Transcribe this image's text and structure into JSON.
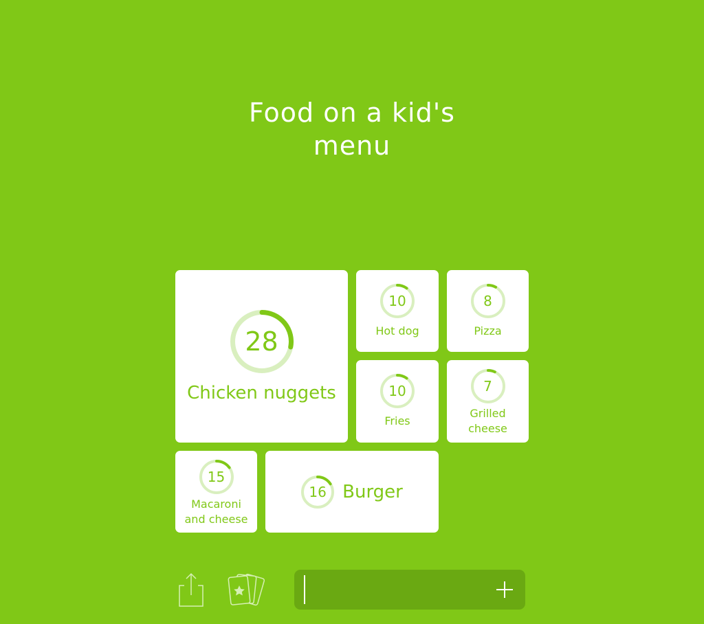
{
  "puzzle": {
    "title": "Food on a kid's menu"
  },
  "answers": [
    {
      "id": "chicken-nuggets",
      "label": "Chicken nuggets",
      "percent": "28",
      "fraction": 0.28
    },
    {
      "id": "hot-dog",
      "label": "Hot dog",
      "percent": "10",
      "fraction": 0.1
    },
    {
      "id": "pizza",
      "label": "Pizza",
      "percent": "8",
      "fraction": 0.08
    },
    {
      "id": "fries",
      "label": "Fries",
      "percent": "10",
      "fraction": 0.1
    },
    {
      "id": "grilled-cheese",
      "label": "Grilled cheese",
      "label_lines": [
        "Grilled",
        "cheese"
      ],
      "percent": "7",
      "fraction": 0.07
    },
    {
      "id": "macaroni-and-cheese",
      "label": "Macaroni and cheese",
      "label_lines": [
        "Macaroni",
        "and cheese"
      ],
      "percent": "15",
      "fraction": 0.15
    },
    {
      "id": "burger",
      "label": "Burger",
      "percent": "16",
      "fraction": 0.16
    }
  ],
  "toolbar": {
    "share_icon": "share-icon",
    "hints_icon": "cards-star-icon",
    "input_value": "",
    "add_icon": "plus-icon"
  },
  "colors": {
    "background": "#80c817",
    "accent": "#80c817",
    "ring_track": "#d9efbf",
    "input_bg": "#6aa912"
  }
}
